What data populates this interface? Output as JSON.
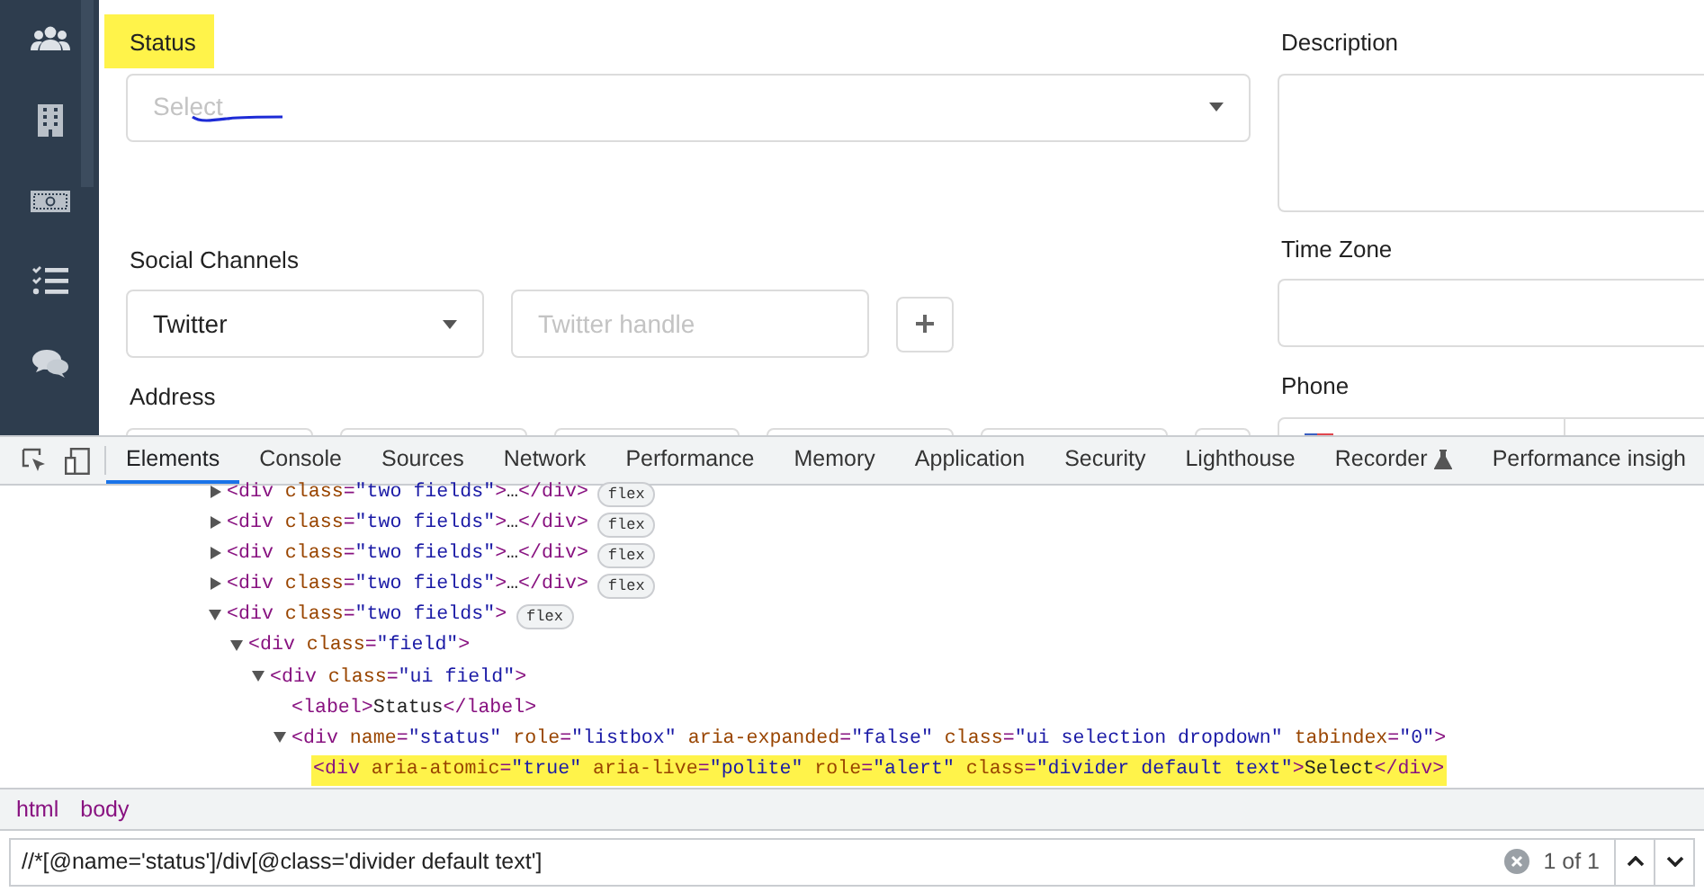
{
  "form": {
    "status": {
      "label": "Status",
      "label_highlighted": true,
      "placeholder": "Select",
      "scribble": true
    },
    "description": {
      "label": "Description"
    },
    "social_channels": {
      "label": "Social Channels",
      "network": "Twitter",
      "handle_placeholder": "Twitter handle"
    },
    "time_zone": {
      "label": "Time Zone"
    },
    "address": {
      "label": "Address"
    },
    "phone": {
      "label": "Phone"
    }
  },
  "devtools": {
    "tabs": [
      {
        "label": "Elements",
        "selected": true,
        "experimental": false
      },
      {
        "label": "Console",
        "selected": false,
        "experimental": false
      },
      {
        "label": "Sources",
        "selected": false,
        "experimental": false
      },
      {
        "label": "Network",
        "selected": false,
        "experimental": false
      },
      {
        "label": "Performance",
        "selected": false,
        "experimental": false
      },
      {
        "label": "Memory",
        "selected": false,
        "experimental": false
      },
      {
        "label": "Application",
        "selected": false,
        "experimental": false
      },
      {
        "label": "Security",
        "selected": false,
        "experimental": false
      },
      {
        "label": "Lighthouse",
        "selected": false,
        "experimental": false
      },
      {
        "label": "Recorder",
        "selected": false,
        "experimental": true
      },
      {
        "label": "Performance insigh",
        "selected": false,
        "experimental": false
      }
    ],
    "dom_tree": [
      {
        "markup": "<div class=\"two fields\">…</div>",
        "expanded": false,
        "badge": "flex"
      },
      {
        "markup": "<div class=\"two fields\">…</div>",
        "expanded": false,
        "badge": "flex"
      },
      {
        "markup": "<div class=\"two fields\">…</div>",
        "expanded": false,
        "badge": "flex"
      },
      {
        "markup": "<div class=\"two fields\">…</div>",
        "expanded": false,
        "badge": "flex"
      },
      {
        "markup": "<div class=\"two fields\">",
        "expanded": true,
        "badge": "flex",
        "children": [
          {
            "markup": "<div class=\"field\">",
            "expanded": true,
            "children": [
              {
                "markup": "<div class=\"ui field\">",
                "expanded": true,
                "children": [
                  {
                    "markup": "<label>Status</label>"
                  },
                  {
                    "markup": "<div name=\"status\" role=\"listbox\" aria-expanded=\"false\" class=\"ui selection dropdown\" tabindex=\"0\">",
                    "expanded": true,
                    "children": [
                      {
                        "markup": "<div aria-atomic=\"true\" aria-live=\"polite\" role=\"alert\" class=\"divider default text\">Select</div>",
                        "highlighted": true
                      }
                    ]
                  }
                ]
              }
            ]
          }
        ]
      }
    ],
    "breadcrumbs": [
      {
        "label": "html"
      },
      {
        "label": "body"
      }
    ],
    "search": {
      "value": "//*[@name='status']/div[@class='divider default text']",
      "match_count": "1 of 1"
    }
  }
}
